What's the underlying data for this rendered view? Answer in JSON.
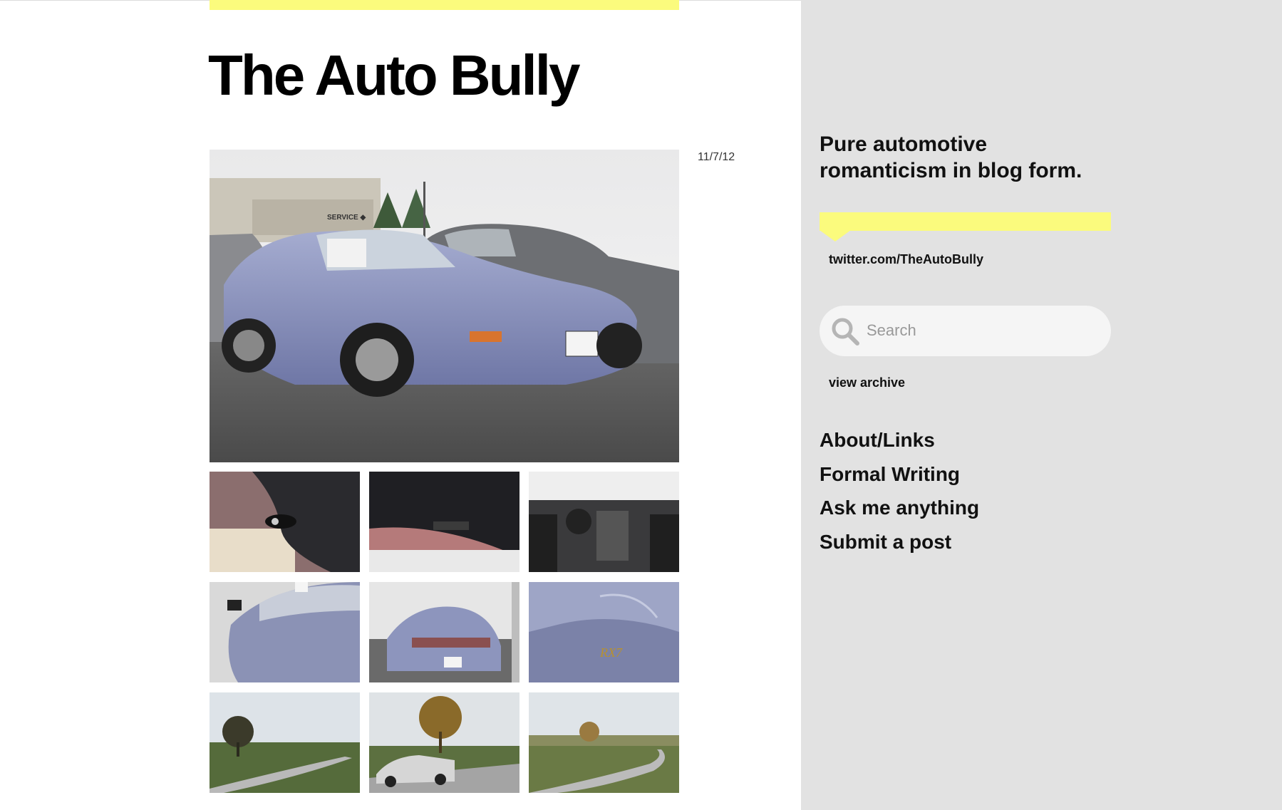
{
  "blog": {
    "title": "The Auto Bully",
    "accent_color": "#fbfb7d",
    "sidebar_bg": "#e2e2e2"
  },
  "post": {
    "date": "11/7/12",
    "main_photo": "photo-blue-rx7-front",
    "thumbnails": [
      "photo-headliner-dome-light",
      "photo-headliner-sunroof",
      "photo-dashboard-interior",
      "photo-side-door-mirror",
      "photo-rear-view-lot",
      "photo-rear-quarter-badge",
      "photo-country-road-trees",
      "photo-silver-miata-road",
      "photo-rolling-hills-road"
    ]
  },
  "sidebar": {
    "tagline": "Pure automotive romanticism in blog form.",
    "twitter_label": "twitter.com/TheAutoBully",
    "search_placeholder": "Search",
    "archive_label": "view archive",
    "nav": [
      {
        "label": "About/Links"
      },
      {
        "label": "Formal Writing"
      },
      {
        "label": "Ask me anything"
      },
      {
        "label": "Submit a post"
      }
    ]
  }
}
